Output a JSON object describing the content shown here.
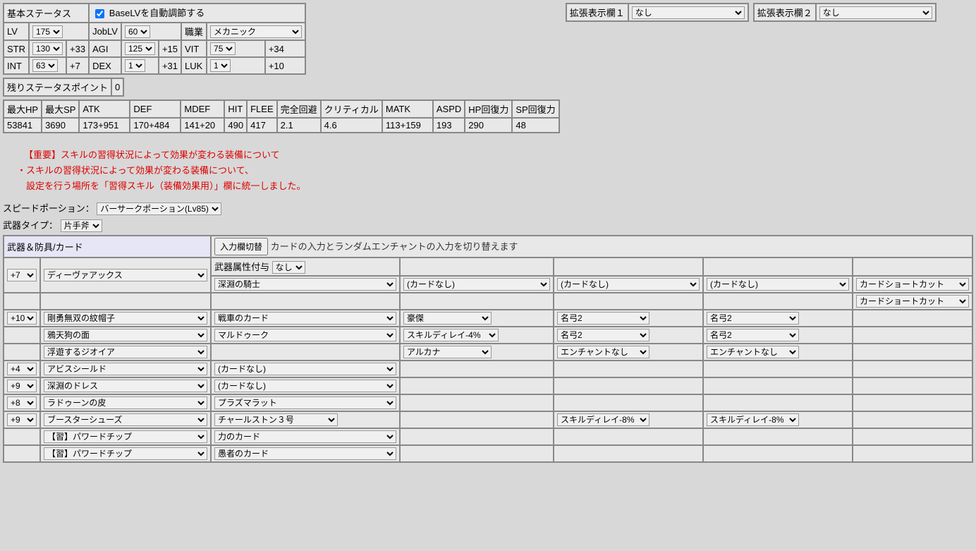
{
  "base_status_title": "基本ステータス",
  "auto_adjust_label": "BaseLVを自動調節する",
  "ext1_label": "拡張表示欄１",
  "ext1_value": "なし",
  "ext2_label": "拡張表示欄２",
  "ext2_value": "なし",
  "lv_label": "LV",
  "lv_value": "175",
  "joblv_label": "JobLV",
  "joblv_value": "60",
  "job_label": "職業",
  "job_value": "メカニック",
  "str_label": "STR",
  "str_value": "130",
  "str_bonus": "+33",
  "agi_label": "AGI",
  "agi_value": "125",
  "agi_bonus": "+15",
  "vit_label": "VIT",
  "vit_value": "75",
  "vit_bonus": "+34",
  "int_label": "INT",
  "int_value": "63",
  "int_bonus": "+7",
  "dex_label": "DEX",
  "dex_value": "1",
  "dex_bonus": "+31",
  "luk_label": "LUK",
  "luk_value": "1",
  "luk_bonus": "+10",
  "remain_label": "残りステータスポイント",
  "remain_value": "0",
  "h_maxhp": "最大HP",
  "v_maxhp": "53841",
  "h_maxsp": "最大SP",
  "v_maxsp": "3690",
  "h_atk": "ATK",
  "v_atk": "173+951",
  "h_def": "DEF",
  "v_def": "170+484",
  "h_mdef": "MDEF",
  "v_mdef": "141+20",
  "h_hit": "HIT",
  "v_hit": "490",
  "h_flee": "FLEE",
  "v_flee": "417",
  "h_pd": "完全回避",
  "v_pd": "2.1",
  "h_cri": "クリティカル",
  "v_cri": "4.6",
  "h_matk": "MATK",
  "v_matk": "113+159",
  "h_aspd": "ASPD",
  "v_aspd": "193",
  "h_hprec": "HP回復力",
  "v_hprec": "290",
  "h_sprec": "SP回復力",
  "v_sprec": "48",
  "notice_title": "【重要】スキルの習得状況によって効果が変わる装備について",
  "notice_l1": "・スキルの習得状況によって効果が変わる装備について、",
  "notice_l2": "　設定を行う場所を「習得スキル（装備効果用）」欄に統一しました。",
  "speed_label": "スピードポーション：",
  "speed_value": "バーサークポーション(Lv85)",
  "wtype_label": "武器タイプ：",
  "wtype_value": "片手斧",
  "eq_header": "武器＆防具/カード",
  "swap_btn": "入力欄切替",
  "swap_desc": "カードの入力とランダムエンチャントの入力を切り替えます",
  "watt_label": "武器属性付与",
  "watt_value": "なし",
  "card_shortcut": "カードショートカット",
  "card_none": "(カードなし)",
  "enc_none": "エンチャントなし",
  "r0_ref": "+7",
  "r0_item": "ディーヴァアックス",
  "r0_c1": "深淵の騎士",
  "r2_ref": "+10",
  "r2_item": "剛勇無双の紋帽子",
  "r2_c1": "戦車のカード",
  "r2_c2": "豪傑",
  "r2_c3": "名弓2",
  "r2_c4": "名弓2",
  "r3_item": "鴉天狗の面",
  "r3_c1": "マルドゥーク",
  "r3_c2": "スキルディレイ-4%",
  "r3_c3": "名弓2",
  "r3_c4": "名弓2",
  "r4_item": "浮遊するジオイア",
  "r4_c2": "アルカナ",
  "r5_ref": "+4",
  "r5_item": "アビスシールド",
  "r6_ref": "+9",
  "r6_item": "深淵のドレス",
  "r7_ref": "+8",
  "r7_item": "ラドゥーンの皮",
  "r7_c1": "プラズマラット",
  "r8_ref": "+9",
  "r8_item": "ブースターシューズ",
  "r8_c1": "チャールストン３号",
  "r8_c3": "スキルディレイ-8%",
  "r8_c4": "スキルディレイ-8%",
  "r9_item": "【習】パワードチップ",
  "r9_c1": "力のカード",
  "r10_item": "【習】パワードチップ",
  "r10_c1": "愚者のカード"
}
